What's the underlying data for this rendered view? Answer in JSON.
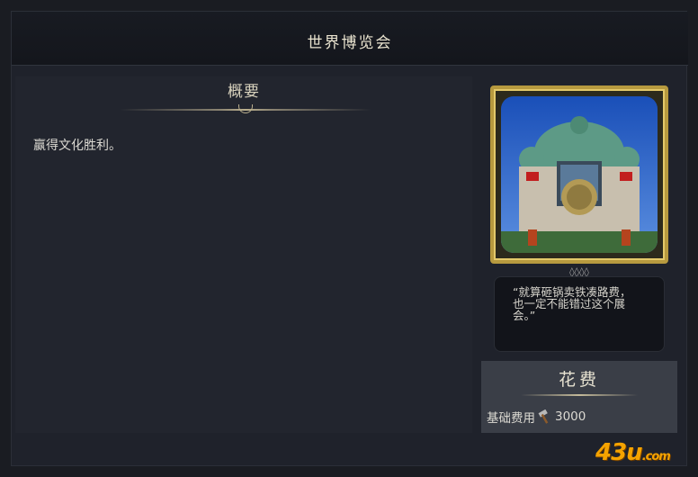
{
  "window": {
    "title": "世界博览会"
  },
  "overview": {
    "heading": "概要",
    "description": "赢得文化胜利。"
  },
  "wonder": {
    "quote": "“就算砸锅卖铁凑路费，\n也一定不能错过这个展\n会。”"
  },
  "cost": {
    "heading": "花费",
    "base_label": "基础费用",
    "value": "3000"
  },
  "watermark": {
    "text": "43u",
    "suffix": ".com"
  },
  "colors": {
    "gold_frame": "#b79a3f",
    "watermark": "#f5a300"
  }
}
